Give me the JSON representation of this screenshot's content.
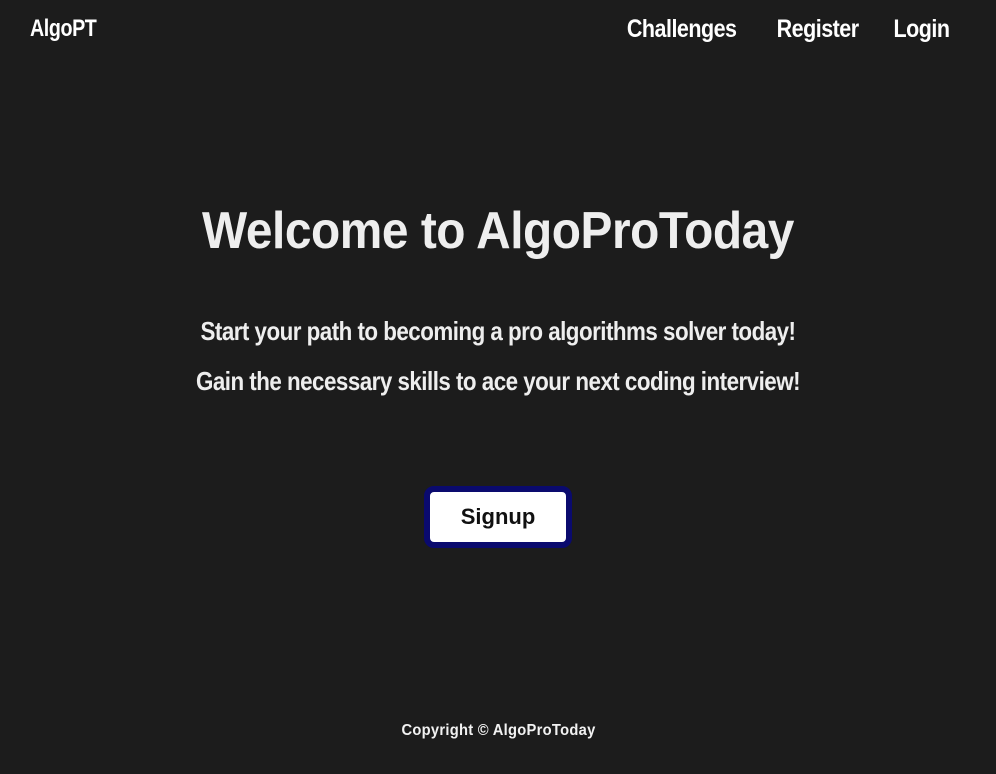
{
  "nav": {
    "brand": "AlgoPT",
    "links": [
      "Challenges",
      "Register",
      "Login"
    ]
  },
  "hero": {
    "title": "Welcome to AlgoProToday",
    "subtitle_line1": "Start your path to becoming a pro algorithms solver today!",
    "subtitle_line2": "Gain the necessary skills to ace your next coding interview!",
    "signup_label": "Signup"
  },
  "footer": {
    "copyright": "Copyright © AlgoProToday"
  },
  "colors": {
    "background": "#1c1c1c",
    "text": "#f5f5f5",
    "button_bg": "#ffffff",
    "button_border": "#0a0a6e"
  }
}
